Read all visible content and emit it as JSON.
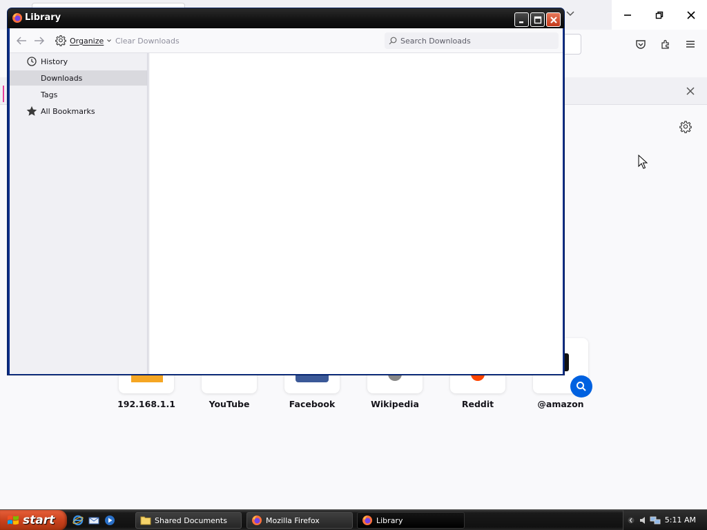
{
  "library": {
    "title": "Library",
    "toolbar": {
      "organize_label": "Organize",
      "clear_label": "Clear Downloads",
      "search_placeholder": "Search Downloads"
    },
    "sidebar": {
      "items": [
        {
          "label": "History",
          "icon": "clock-icon",
          "selected": false
        },
        {
          "label": "Downloads",
          "icon": "",
          "selected": true
        },
        {
          "label": "Tags",
          "icon": "",
          "selected": false
        },
        {
          "label": "All Bookmarks",
          "icon": "star-icon",
          "selected": false
        }
      ]
    }
  },
  "top_sites": [
    {
      "label": "192.168.1.1"
    },
    {
      "label": "YouTube"
    },
    {
      "label": "Facebook"
    },
    {
      "label": "Wikipedia"
    },
    {
      "label": "Reddit"
    },
    {
      "label": "@amazon"
    }
  ],
  "taskbar": {
    "start_label": "start",
    "tasks": [
      {
        "label": "Shared Documents"
      },
      {
        "label": "Mozilla Firefox"
      },
      {
        "label": "Library"
      }
    ],
    "clock": "5:11 AM"
  },
  "colors": {
    "accent_blue": "#0061e0",
    "start_orange": "#c9421d",
    "selection_gray": "#d9d9de"
  }
}
